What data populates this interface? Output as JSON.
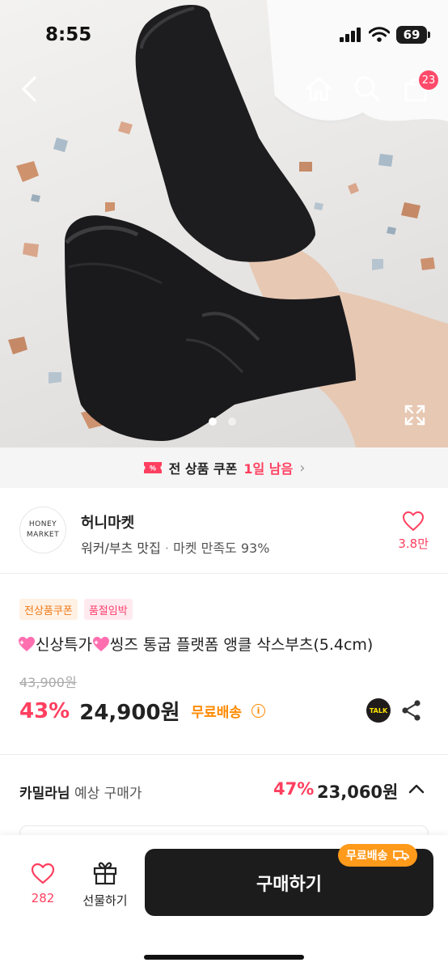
{
  "status": {
    "time": "8:55",
    "battery": "69"
  },
  "nav": {
    "cart_count": "23"
  },
  "gallery": {
    "total_images": 2,
    "active_index": 0
  },
  "coupon_bar": {
    "text": "전 상품 쿠폰",
    "remaining": "1일 남음"
  },
  "shop": {
    "logo_line1": "HONEY",
    "logo_line2": "MARKET",
    "name": "허니마켓",
    "category": "워커/부츠 맛집",
    "separator": "·",
    "satisfaction": "마켓 만족도 93%",
    "like_count": "3.8만"
  },
  "product": {
    "badges": [
      "전상품쿠폰",
      "품절임박"
    ],
    "title_part1": "신상특가",
    "title_part2": "씽즈 통굽 플랫폼 앵클 삭스부츠(5.4cm)",
    "original_price": "43,900원",
    "discount": "43%",
    "price": "24,900원",
    "shipping": "무료배송",
    "talk_label": "TALK"
  },
  "expected": {
    "user": "카밀라님",
    "label": "예상 구매가",
    "discount": "47%",
    "price": "23,060원"
  },
  "bottom_bar": {
    "like_count": "282",
    "gift_label": "선물하기",
    "buy_label": "구매하기",
    "ship_tag": "무료배송"
  },
  "colors": {
    "accent": "#ff3f5f",
    "shipping": "#ff8a00",
    "primary_button": "#1c1c1c"
  }
}
